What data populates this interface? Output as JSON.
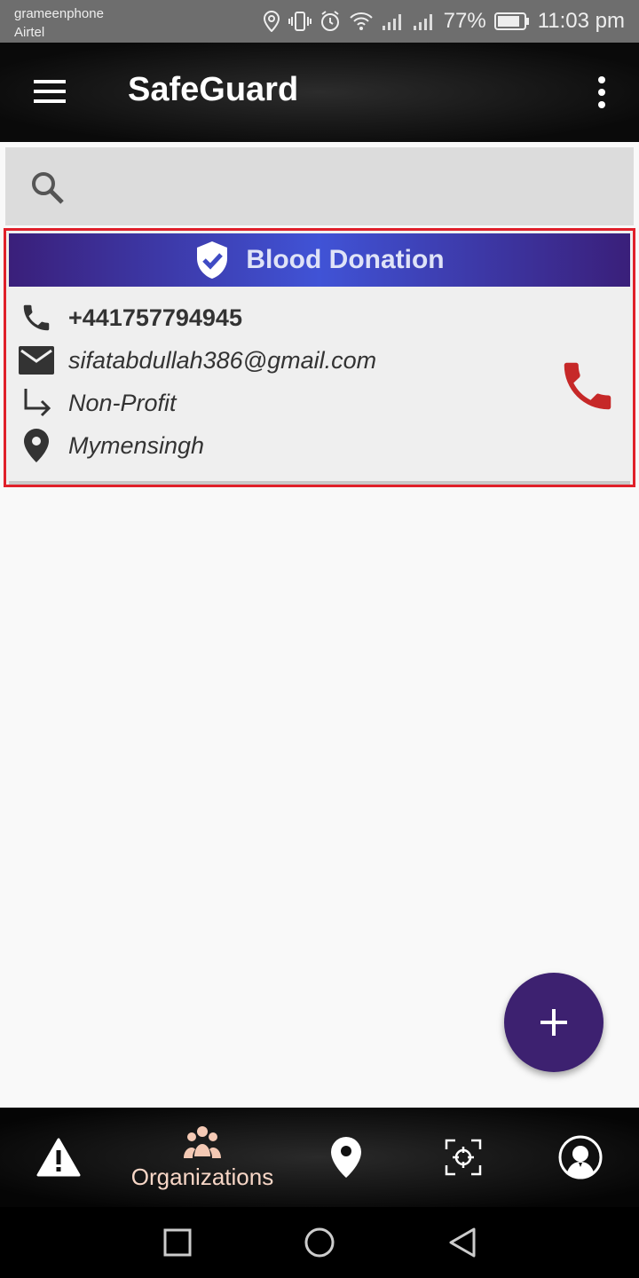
{
  "status_bar": {
    "carrier_1": "grameenphone",
    "carrier_2": "Airtel",
    "battery": "77%",
    "time": "11:03 pm",
    "icons": [
      "location-icon",
      "vibrate-icon",
      "alarm-icon",
      "wifi-icon",
      "signal-icon",
      "signal-icon",
      "battery-icon"
    ]
  },
  "app_bar": {
    "title": "SafeGuard",
    "menu_icon": "hamburger-menu-icon",
    "more_icon": "more-vert-icon"
  },
  "search": {
    "icon": "search-icon",
    "placeholder": ""
  },
  "organization_card": {
    "title": "Blood Donation",
    "badge_icon": "verified-shield-icon",
    "phone": "+441757794945",
    "email": "sifatabdullah386@gmail.com",
    "type": "Non-Profit",
    "location": "Mymensingh",
    "call_icon": "phone-call-icon"
  },
  "fab": {
    "icon": "plus-icon"
  },
  "bottom_nav": {
    "items": [
      {
        "icon": "warning-icon",
        "label": ""
      },
      {
        "icon": "people-group-icon",
        "label": "Organizations",
        "active": true
      },
      {
        "icon": "map-pin-icon",
        "label": ""
      },
      {
        "icon": "crosshair-scan-icon",
        "label": ""
      },
      {
        "icon": "user-avatar-icon",
        "label": ""
      }
    ]
  },
  "colors": {
    "header_gradient_center": "#4053d6",
    "header_gradient_edge": "#3a1f7a",
    "card_border": "#e0202a",
    "call_icon": "#c62828",
    "fab": "#3d2170",
    "active_nav": "#f7d6c6"
  }
}
